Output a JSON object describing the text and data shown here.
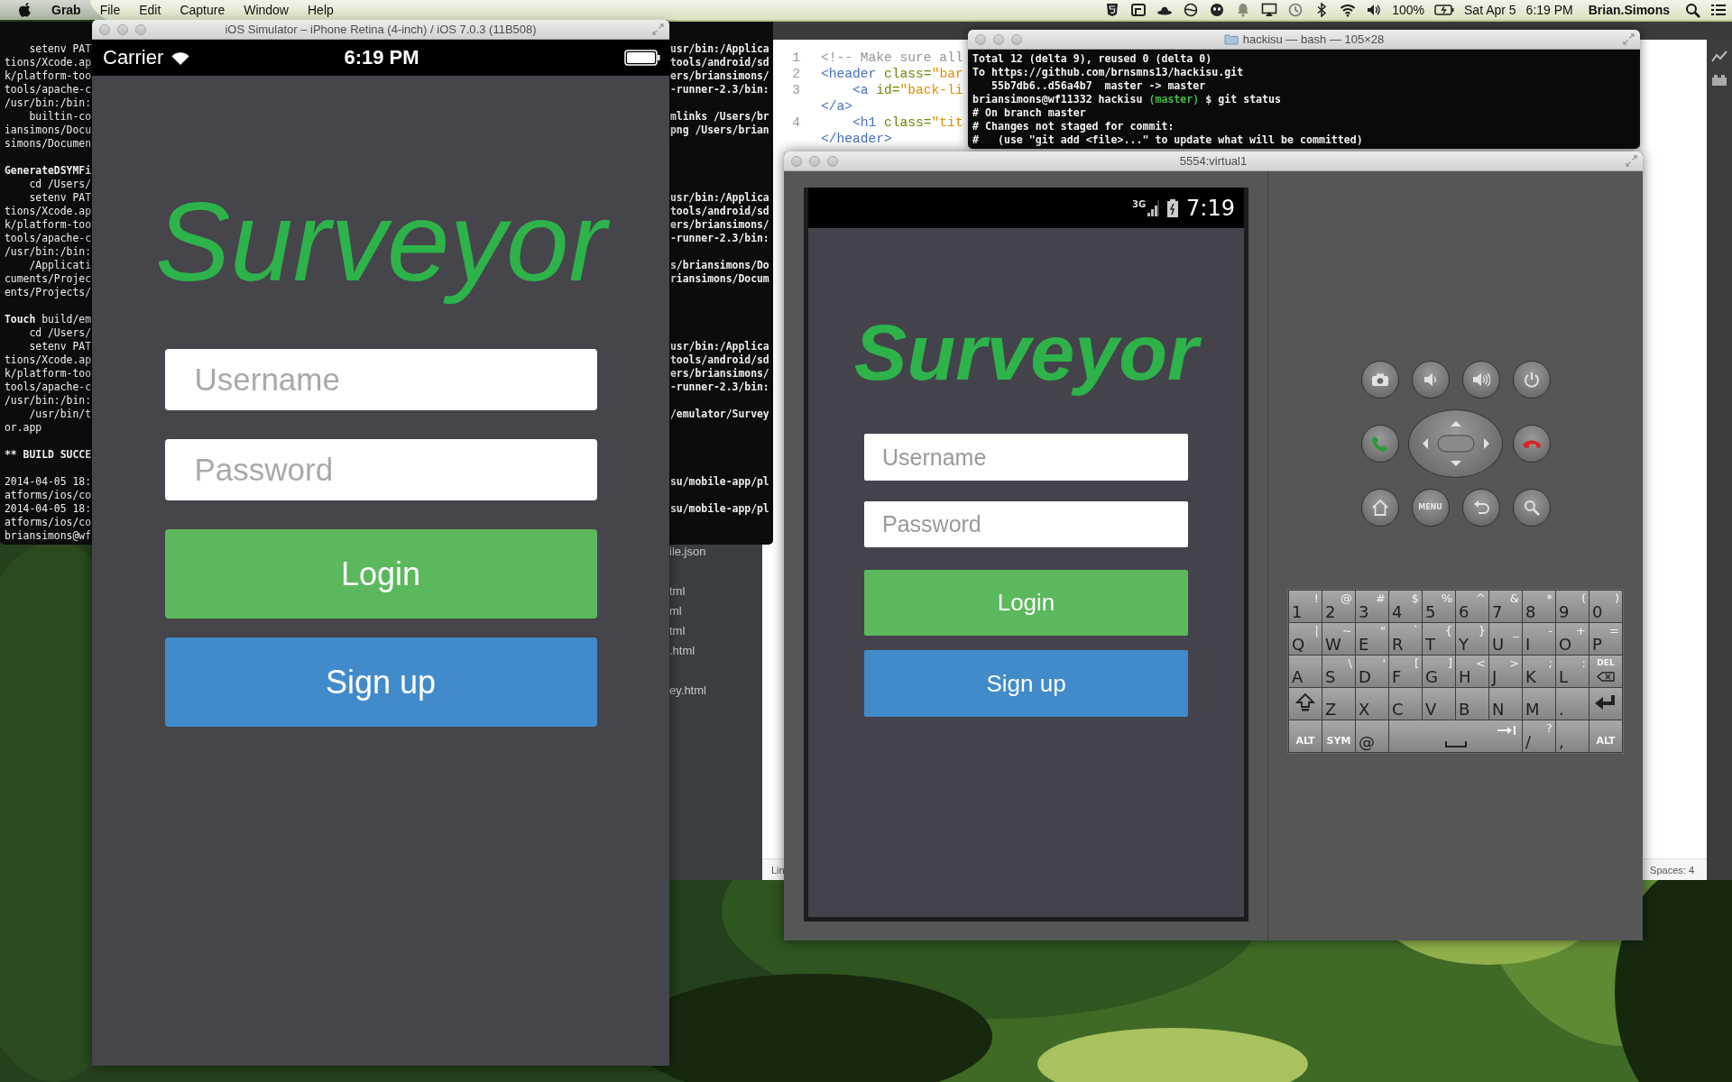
{
  "menu_bar": {
    "app": "Grab",
    "menus": [
      "File",
      "Edit",
      "Capture",
      "Window",
      "Help"
    ],
    "battery_percent": "100%",
    "date": "Sat Apr 5",
    "time": "6:19 PM",
    "user": "Brian.Simons"
  },
  "build_terminal": {
    "rows": [
      {
        "left": "    setenv PAT",
        "right": "usr/bin:/Applica"
      },
      {
        "left": "tions/Xcode.ap",
        "right": "tools/android/sd"
      },
      {
        "left": "k/platform-too",
        "right": "ers/briansimons/"
      },
      {
        "left": "tools/apache-c",
        "right": "-runner-2.3/bin:"
      },
      {
        "left": "/usr/bin:/bin:"
      },
      {
        "left": "    builtin-co",
        "right": "mlinks /Users/br"
      },
      {
        "left": "iansimons/Docu",
        "right": "png /Users/brian"
      },
      {
        "left": "simons/Documen"
      },
      {
        "left": "GenerateDSYMFi",
        "bold": true,
        "space_before": true
      },
      {
        "left": "    cd /Users/"
      },
      {
        "left": "    setenv PAT",
        "right": "usr/bin:/Applica"
      },
      {
        "left": "tions/Xcode.ap",
        "right": "tools/android/sd"
      },
      {
        "left": "k/platform-too",
        "right": "ers/briansimons/"
      },
      {
        "left": "tools/apache-c",
        "right": "-runner-2.3/bin:"
      },
      {
        "left": "/usr/bin:/bin:"
      },
      {
        "left": "    /Applicati",
        "right": "s/briansimons/Do"
      },
      {
        "left": "cuments/Projec",
        "right": "riansimons/Docum"
      },
      {
        "left": "ents/Projects/"
      },
      {
        "left": "**Touch** build/em",
        "space_before": true
      },
      {
        "left": "    cd /Users/"
      },
      {
        "left": "    setenv PAT",
        "right": "usr/bin:/Applica"
      },
      {
        "left": "tions/Xcode.ap",
        "right": "tools/android/sd"
      },
      {
        "left": "k/platform-too",
        "right": "ers/briansimons/"
      },
      {
        "left": "tools/apache-c",
        "right": "-runner-2.3/bin:"
      },
      {
        "left": "/usr/bin:/bin:"
      },
      {
        "left": "    /usr/bin/t",
        "right": "/emulator/Survey"
      },
      {
        "left": "or.app"
      },
      {
        "left": "** BUILD SUCCE",
        "bold": true,
        "space_before": true
      },
      {
        "left": "2014-04-05 18:",
        "right": "su/mobile-app/pl",
        "space_before": true
      },
      {
        "left": "atforms/ios/co"
      },
      {
        "left": "2014-04-05 18:",
        "right": "su/mobile-app/pl"
      },
      {
        "left": "atforms/ios/co"
      },
      {
        "left": "briansimons@wf"
      }
    ]
  },
  "editor": {
    "file_groups": [
      [
        "ile.json"
      ],
      [
        "tml",
        "ml",
        "tml",
        ".html"
      ],
      [
        "ey.html"
      ]
    ],
    "lines": [
      {
        "number": "1",
        "tokens": [
          {
            "kind": "comment",
            "text": "<!-- Make sure all"
          }
        ]
      },
      {
        "number": "2",
        "tokens": [
          {
            "kind": "tag",
            "text": "<header"
          },
          {
            "kind": "attr",
            "text": " class="
          },
          {
            "kind": "string",
            "text": "\"bar"
          }
        ]
      },
      {
        "number": "3",
        "indent": true,
        "tokens": [
          {
            "kind": "tag",
            "text": "<a"
          },
          {
            "kind": "attr",
            "text": " id="
          },
          {
            "kind": "string",
            "text": "\"back-li"
          }
        ]
      },
      {
        "tokens": [
          {
            "kind": "tag",
            "text": "</a>"
          }
        ]
      },
      {
        "number": "4",
        "indent": true,
        "tokens": [
          {
            "kind": "tag",
            "text": "<h1"
          },
          {
            "kind": "attr",
            "text": " class="
          },
          {
            "kind": "string",
            "text": "\"tit"
          }
        ]
      },
      {
        "tokens": [
          {
            "kind": "tag",
            "text": "</header>"
          }
        ]
      }
    ],
    "status_left": "Lin",
    "status_right": "Spaces: 4"
  },
  "ios_simulator": {
    "title": "iOS Simulator – iPhone Retina (4-inch) / iOS 7.0.3 (11B508)",
    "status_bar": {
      "carrier": "Carrier",
      "time": "6:19 PM"
    },
    "app": {
      "title": "Surveyor",
      "username_placeholder": "Username",
      "password_placeholder": "Password",
      "login": "Login",
      "signup": "Sign up"
    }
  },
  "bash_terminal": {
    "title": "hackisu — bash — 105×28",
    "lines": [
      {
        "kind": "output",
        "text": "Total 12 (delta 9), reused 0 (delta 0)"
      },
      {
        "kind": "output",
        "text": "To https://github.com/brnsmns13/hackisu.git"
      },
      {
        "kind": "output",
        "text": "   55b7db6..d56a4b7  master -> master"
      },
      {
        "kind": "prompt",
        "user": "briansimons@wf11332 hackisu",
        "branch": "(master)",
        "command": "$ git status"
      },
      {
        "kind": "output",
        "text": "# On branch master"
      },
      {
        "kind": "output",
        "text": "# Changes not staged for commit:"
      },
      {
        "kind": "output",
        "text": "#   (use \"git add <file>...\" to update what will be committed)"
      }
    ]
  },
  "android_emulator": {
    "title": "5554:virtual1",
    "status_bar": {
      "network": "3G",
      "time": "7:19"
    },
    "app": {
      "title": "Surveyor",
      "username_placeholder": "Username",
      "password_placeholder": "Password",
      "login": "Login",
      "signup": "Sign up"
    },
    "hardware_keys": {
      "menu_label": "MENU"
    },
    "keyboard": {
      "rows": [
        [
          {
            "kind": "char",
            "label": "1",
            "alt": "!"
          },
          {
            "kind": "char",
            "label": "2",
            "alt": "@"
          },
          {
            "kind": "char",
            "label": "3",
            "alt": "#"
          },
          {
            "kind": "char",
            "label": "4",
            "alt": "$"
          },
          {
            "kind": "char",
            "label": "5",
            "alt": "%"
          },
          {
            "kind": "char",
            "label": "6",
            "alt": "^"
          },
          {
            "kind": "char",
            "label": "7",
            "alt": "&"
          },
          {
            "kind": "char",
            "label": "8",
            "alt": "*"
          },
          {
            "kind": "char",
            "label": "9",
            "alt": "("
          },
          {
            "kind": "char",
            "label": "0",
            "alt": ")"
          }
        ],
        [
          {
            "kind": "char",
            "label": "Q",
            "alt": "|"
          },
          {
            "kind": "char",
            "label": "W",
            "alt": "~"
          },
          {
            "kind": "char",
            "label": "E",
            "alt": "\""
          },
          {
            "kind": "char",
            "label": "R",
            "alt": "`"
          },
          {
            "kind": "char",
            "label": "T",
            "alt": "{"
          },
          {
            "kind": "char",
            "label": "Y",
            "alt": "}"
          },
          {
            "kind": "char",
            "label": "U",
            "alt": "_"
          },
          {
            "kind": "char",
            "label": "I",
            "alt": "-"
          },
          {
            "kind": "char",
            "label": "O",
            "alt": "+"
          },
          {
            "kind": "char",
            "label": "P",
            "alt": "="
          }
        ],
        [
          {
            "kind": "char",
            "label": "A"
          },
          {
            "kind": "char",
            "label": "S",
            "alt": "\\"
          },
          {
            "kind": "char",
            "label": "D",
            "alt": "'"
          },
          {
            "kind": "char",
            "label": "F",
            "alt": "["
          },
          {
            "kind": "char",
            "label": "G",
            "alt": "]"
          },
          {
            "kind": "char",
            "label": "H",
            "alt": "<"
          },
          {
            "kind": "char",
            "label": "J",
            "alt": ">"
          },
          {
            "kind": "char",
            "label": "K",
            "alt": ";"
          },
          {
            "kind": "char",
            "label": "L",
            "alt": ":"
          },
          {
            "kind": "del",
            "label": "DEL"
          }
        ],
        [
          {
            "kind": "shift"
          },
          {
            "kind": "char",
            "label": "Z"
          },
          {
            "kind": "char",
            "label": "X"
          },
          {
            "kind": "char",
            "label": "C"
          },
          {
            "kind": "char",
            "label": "V"
          },
          {
            "kind": "char",
            "label": "B"
          },
          {
            "kind": "char",
            "label": "N"
          },
          {
            "kind": "char",
            "label": "M"
          },
          {
            "kind": "char",
            "label": "."
          },
          {
            "kind": "enter"
          }
        ],
        [
          {
            "kind": "mod",
            "label": "ALT"
          },
          {
            "kind": "mod",
            "label": "SYM"
          },
          {
            "kind": "char",
            "label": "@"
          },
          {
            "kind": "space"
          },
          "",
          "",
          "",
          {
            "kind": "char",
            "label": "/",
            "alt": "?"
          },
          {
            "kind": "char",
            "label": ","
          },
          {
            "kind": "mod",
            "label": "ALT"
          }
        ]
      ]
    }
  }
}
